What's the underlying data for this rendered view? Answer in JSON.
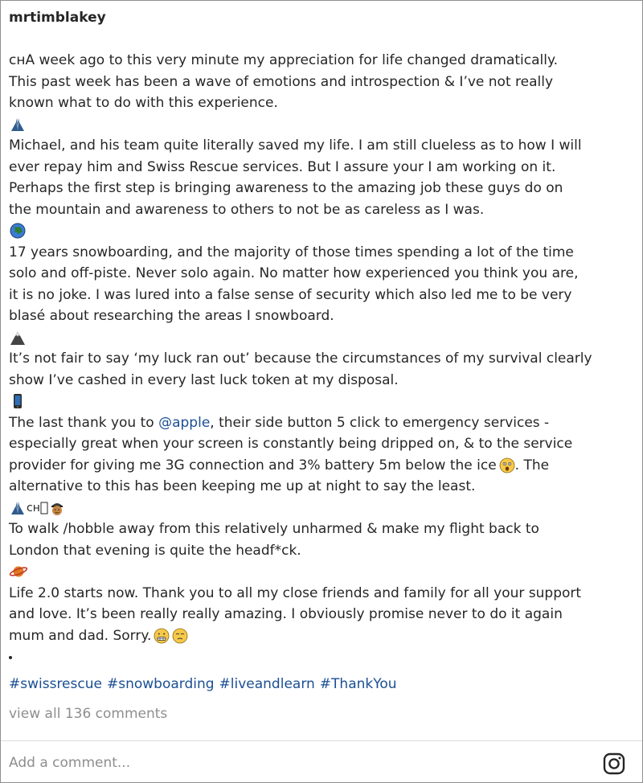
{
  "post": {
    "username": "mrtimblakey",
    "lines": [
      "ᴄʜA week ago to this very minute my appreciation for life changed dramatically.",
      "This past week has been a wave of emotions and introspection & I’ve not really",
      "known what to do with this experience.",
      "Michael, and his team quite literally saved my life. I am still clueless as to how I will",
      "ever repay him and Swiss Rescue services. But I assure your I am working on it.",
      "Perhaps the first step is bringing awareness to the amazing job these guys do on",
      "the mountain and awareness to others to not be as careless as I was.",
      "17 years snowboarding, and the majority of those times spending a lot of the time",
      "solo and off-piste. Never solo again. No matter how experienced you think you are,",
      "it is no joke. I was lured into a false sense of security which also led me to be very",
      "blasé about researching the areas I snowboard.",
      "It’s not fair to say ‘my luck ran out’ because the circumstances of my survival clearly",
      "show I’ve cashed in every last luck token at my disposal.",
      "The last thank you to ",
      "@apple",
      ", their side button 5 click to emergency services -",
      "especially great when your screen is constantly being dripped on, & to the service",
      "provider for giving me 3G connection and 3% battery 5m below the ice",
      ". The",
      "alternative to this has been keeping me up at night to say the least.",
      "ᴄʜ",
      "To walk /hobble away from this relatively unharmed & make my flight back to",
      "London that evening is quite the headf*ck.",
      "Life 2.0 starts now. Thank you to all my close friends and family for all your support",
      "and love. It’s been really really amazing. I obviously promise never to do it again",
      "mum and dad. Sorry."
    ],
    "hashtags": [
      "#swissrescue",
      "#snowboarding",
      "#liveandlearn",
      "#ThankYou"
    ],
    "view_all_comments": "view all 136 comments",
    "comment_placeholder": "Add a comment..."
  },
  "icons": {
    "praying_hands": "praying-hands-icon",
    "globe": "globe-icon",
    "mountain": "mountain-icon",
    "phone": "mobile-phone-icon",
    "astonished": "astonished-face-icon",
    "box": "missing-glyph-icon",
    "rescue_worker": "rescue-worker-icon",
    "planet": "ringed-planet-icon",
    "grimacing": "grimacing-face-icon",
    "relieved": "relieved-face-icon",
    "instagram": "instagram-icon"
  },
  "colors": {
    "text": "#262626",
    "link": "#1b4f93",
    "muted": "#8e8e8e",
    "divider": "#dbdbdb"
  }
}
